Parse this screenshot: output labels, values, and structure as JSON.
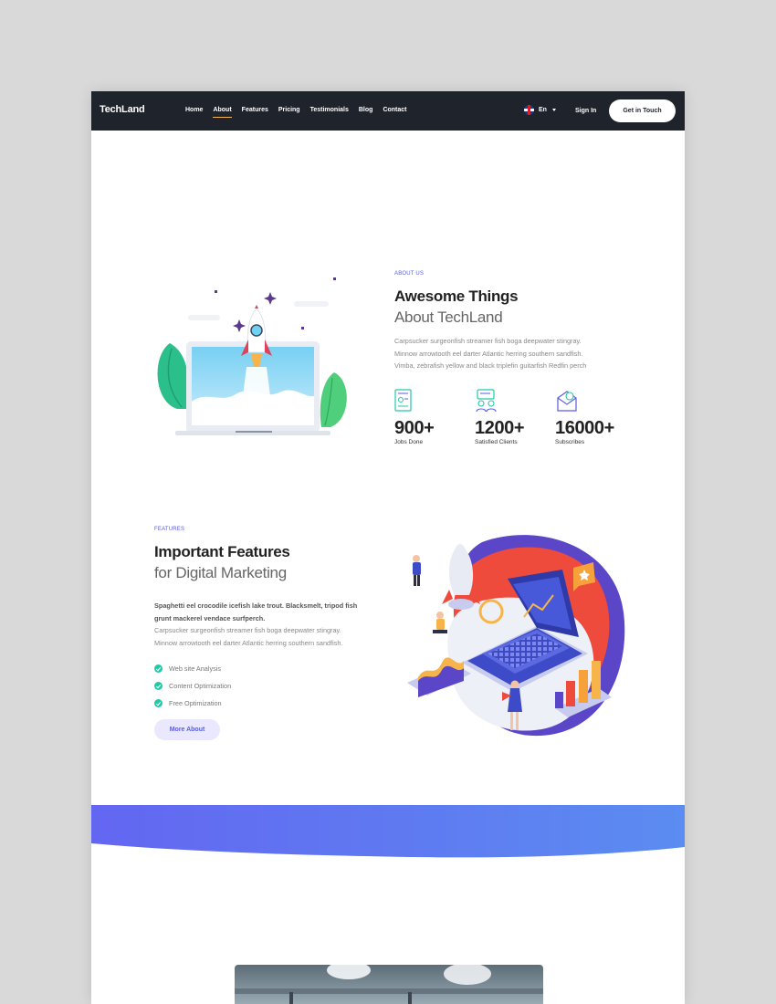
{
  "nav": {
    "logo": "TechLand",
    "menu": [
      "Home",
      "About",
      "Features",
      "Pricing",
      "Testimonials",
      "Blog",
      "Contact"
    ],
    "active_item": "About",
    "language": "En",
    "signin": "Sign In",
    "cta": "Get in Touch"
  },
  "about": {
    "eyebrow": "ABOUT US",
    "title_strong": "Awesome Things",
    "title_light": "About TechLand",
    "body": [
      "Carpsucker surgeonfish streamer fish boga deepwater stingray.",
      "Minnow arrowtooth eel darter Atlantic herring southern sandfish.",
      "Vimba, zebrafish yellow and black triplefin guitarfish Redfin perch"
    ],
    "stats": [
      {
        "value": "900+",
        "label": "Jobs Done",
        "icon": "document-chart-icon"
      },
      {
        "value": "1200+",
        "label": "Satisfied Clients",
        "icon": "clients-icon"
      },
      {
        "value": "16000+",
        "label": "Subscribes",
        "icon": "mail-icon"
      }
    ]
  },
  "features": {
    "eyebrow": "FEATURES",
    "title_strong": "Important Features",
    "title_light": "for Digital Marketing",
    "lead": [
      "Spaghetti eel crocodile icefish lake trout. Blacksmelt, tripod fish",
      "grunt mackerel vendace surfperch."
    ],
    "body": [
      "Carpsucker surgeonfish streamer fish boga deepwater stingray.",
      "Minnow arrowtooth eel darter Atlantic herring southern sandfish."
    ],
    "checklist": [
      "Web site Analysis",
      "Content Optimization",
      "Free Optimization"
    ],
    "button": "More About"
  },
  "colors": {
    "nav_bg": "#1f232c",
    "accent": "#5a5ce0",
    "nav_underline": "#f6b44b",
    "check": "#22c9a6",
    "wave_start": "#6366f1",
    "wave_end": "#5b8cf1"
  }
}
